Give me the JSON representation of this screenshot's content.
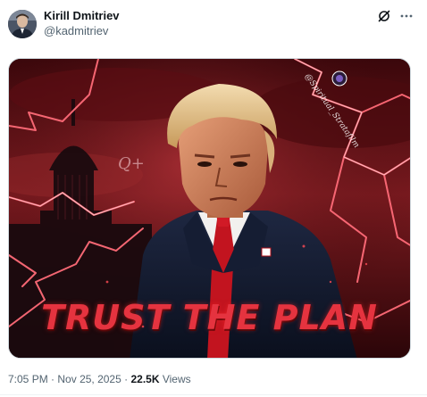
{
  "author": {
    "name": "Kirill Dmitriev",
    "handle": "@kadmitriev"
  },
  "header_icons": [
    "grok-icon",
    "more-icon"
  ],
  "media": {
    "overlay_text": "TRUST THE PLAN",
    "watermark": "@Spiritual_Stratafilm",
    "colors": {
      "sky": "#6b1117",
      "lightning": "#ff5a6a",
      "title": "#e5333f"
    }
  },
  "meta": {
    "time": "7:05 PM",
    "separator": "·",
    "date": "Nov 25, 2025",
    "views_count": "22.5K",
    "views_label": "Views"
  }
}
